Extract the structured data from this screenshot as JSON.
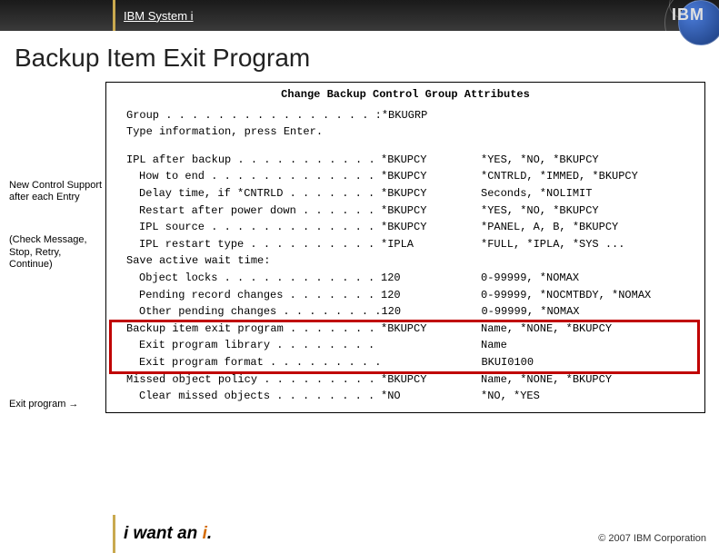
{
  "header": {
    "system": "IBM System i",
    "logo_text": "IBM"
  },
  "slide_title": "Backup Item Exit Program",
  "left_notes": {
    "new_control": "New Control Support  after each Entry",
    "check": "(Check Message, Stop, Retry, Continue)",
    "exit": "Exit program →"
  },
  "terminal": {
    "title": "Change Backup Control Group Attributes",
    "group_label": "Group  . . . . . . . . . . . . . . . . :",
    "group_value": "*BKUGRP",
    "type_info": "Type information, press Enter.",
    "rows": [
      {
        "label": "IPL after backup  . . . . . . . . . . .",
        "value": "*BKUPCY",
        "opts": "*YES, *NO, *BKUPCY",
        "indent": 1
      },
      {
        "label": "How to end  . . . . . . . . . . . . .",
        "value": "*BKUPCY",
        "opts": "*CNTRLD, *IMMED, *BKUPCY",
        "indent": 2
      },
      {
        "label": "Delay time, if *CNTRLD  . . . . . . .",
        "value": "*BKUPCY",
        "opts": "Seconds, *NOLIMIT",
        "indent": 2
      },
      {
        "label": "Restart after power down  . . . . . .",
        "value": "*BKUPCY",
        "opts": "*YES, *NO, *BKUPCY",
        "indent": 2
      },
      {
        "label": "IPL source  . . . . . . . . . . . . .",
        "value": "*BKUPCY",
        "opts": "*PANEL, A, B, *BKUPCY",
        "indent": 2
      },
      {
        "label": "IPL restart type  . . . . . . . . . .",
        "value": "*IPLA",
        "opts": "*FULL, *IPLA, *SYS ...",
        "indent": 2
      },
      {
        "label": "Save active wait time:",
        "value": "",
        "opts": "",
        "indent": 1
      },
      {
        "label": "Object locks  . . . . . . . . . . . .",
        "value": "120",
        "opts": "0-99999, *NOMAX",
        "indent": 2
      },
      {
        "label": "Pending record changes  . . . . . . .",
        "value": "120",
        "opts": "0-99999, *NOCMTBDY, *NOMAX",
        "indent": 2
      },
      {
        "label": "Other pending changes . . . . . . . .",
        "value": "120",
        "opts": "0-99999, *NOMAX",
        "indent": 2
      },
      {
        "label": "Backup item exit program  . . . . . . .",
        "value": "*BKUPCY",
        "opts": "Name, *NONE, *BKUPCY",
        "indent": 1
      },
      {
        "label": "Exit program library  . . . . . . . .",
        "value": "",
        "opts": "Name",
        "indent": 2
      },
      {
        "label": "Exit program format . . . . . . . . .",
        "value": "",
        "opts": "BKUI0100",
        "indent": 2
      },
      {
        "label": "Missed object policy  . . . . . . . . .",
        "value": "*BKUPCY",
        "opts": "Name, *NONE, *BKUPCY",
        "indent": 1
      },
      {
        "label": "Clear missed objects  . . . . . . . .",
        "value": "*NO",
        "opts": "*NO, *YES",
        "indent": 2
      }
    ]
  },
  "footer": {
    "tag_pre": "i want an ",
    "tag_i": "i",
    "tag_post": ".",
    "copyright": "© 2007 IBM Corporation"
  }
}
